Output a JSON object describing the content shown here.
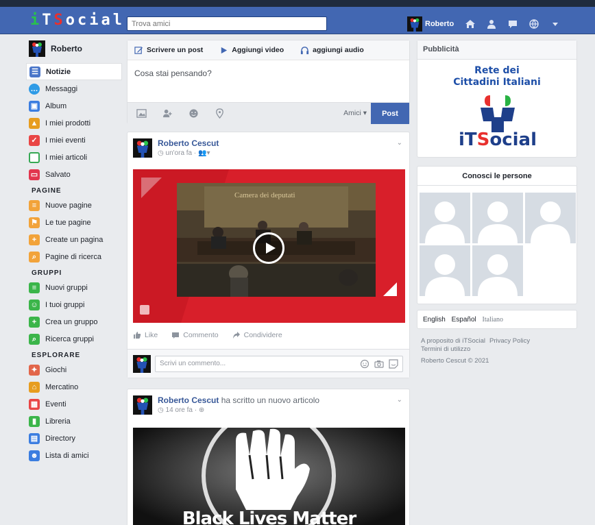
{
  "topbar": {
    "logo": {
      "l1": "i",
      "l2": "T",
      "l3": "S",
      "l4": "ocial"
    },
    "search_placeholder": "Trova amici",
    "user_name": "Roberto",
    "icons": [
      "home-icon",
      "friends-icon",
      "messages-icon",
      "globe-icon",
      "dropdown-icon"
    ]
  },
  "sidebar": {
    "user_name": "Roberto",
    "items": [
      {
        "label": "Notizie",
        "icon": "news-icon",
        "color": "#4a76c9"
      },
      {
        "label": "Messaggi",
        "icon": "messages-icon",
        "color": "#2f9be6"
      },
      {
        "label": "Album",
        "icon": "album-icon",
        "color": "#3b7de0"
      },
      {
        "label": "I miei prodotti",
        "icon": "products-icon",
        "color": "#e79d1f"
      },
      {
        "label": "I miei eventi",
        "icon": "events-icon",
        "color": "#e94545"
      },
      {
        "label": "I miei articoli",
        "icon": "articles-icon",
        "color": "#35a853"
      },
      {
        "label": "Salvato",
        "icon": "saved-icon",
        "color": "#e2364e"
      }
    ],
    "section_pages": "PAGINE",
    "pages": [
      {
        "label": "Nuove pagine",
        "icon": "new-pages-icon",
        "color": "#f2a33a"
      },
      {
        "label": "Le tue pagine",
        "icon": "your-pages-icon",
        "color": "#f2a33a"
      },
      {
        "label": "Create un pagina",
        "icon": "create-page-icon",
        "color": "#f2a33a"
      },
      {
        "label": "Pagine di ricerca",
        "icon": "search-pages-icon",
        "color": "#f2a33a"
      }
    ],
    "section_groups": "GRUPPI",
    "groups": [
      {
        "label": "Nuovi gruppi",
        "icon": "new-groups-icon",
        "color": "#3bb54a"
      },
      {
        "label": "I tuoi gruppi",
        "icon": "your-groups-icon",
        "color": "#3bb54a"
      },
      {
        "label": "Crea un gruppo",
        "icon": "create-group-icon",
        "color": "#3bb54a"
      },
      {
        "label": "Ricerca gruppi",
        "icon": "search-groups-icon",
        "color": "#3bb54a"
      }
    ],
    "section_explore": "ESPLORARE",
    "explore": [
      {
        "label": "Giochi",
        "icon": "games-icon",
        "color": "#e2664a"
      },
      {
        "label": "Mercatino",
        "icon": "market-icon",
        "color": "#e79d1f"
      },
      {
        "label": "Eventi",
        "icon": "events-icon",
        "color": "#e94545"
      },
      {
        "label": "Libreria",
        "icon": "library-icon",
        "color": "#3bb54a"
      },
      {
        "label": "Directory",
        "icon": "directory-icon",
        "color": "#3b7de0"
      },
      {
        "label": "Lista di amici",
        "icon": "friends-list-icon",
        "color": "#3b7de0"
      }
    ]
  },
  "composer": {
    "tab_post": "Scrivere un post",
    "tab_video": "Aggiungi video",
    "tab_audio": "aggiungi audio",
    "placeholder": "Cosa stai pensando?",
    "audience": "Amici",
    "post_button": "Post"
  },
  "post1": {
    "author": "Roberto Cescut",
    "time": "un'ora fa",
    "video_caption": "Camera dei deputati",
    "like": "Like",
    "comment": "Commento",
    "share": "Condividere",
    "comment_placeholder": "Scrivi un commento..."
  },
  "post2": {
    "author": "Roberto Cescut",
    "action": "ha scritto un nuovo articolo",
    "time": "14 ore fa",
    "image_text": "Black Lives Matter"
  },
  "ads": {
    "title": "Pubblicità",
    "ad_line1": "Rete dei",
    "ad_line2": "Cittadini Italiani",
    "logo": {
      "a": "i",
      "b": "T",
      "c": "S",
      "d": "ocial"
    }
  },
  "people": {
    "title": "Conosci le persone"
  },
  "languages": [
    "English",
    "Español",
    "Italiano"
  ],
  "footer": {
    "about": "A proposito di iTSocial",
    "privacy": "Privacy Policy",
    "terms": "Termini di utilizzo",
    "copyright": "Roberto Cescut © 2021"
  },
  "colors": {
    "topbar": "#4267b2",
    "accent": "#385898",
    "post_button": "#4267b2",
    "video_bg": "#d81f2a"
  }
}
